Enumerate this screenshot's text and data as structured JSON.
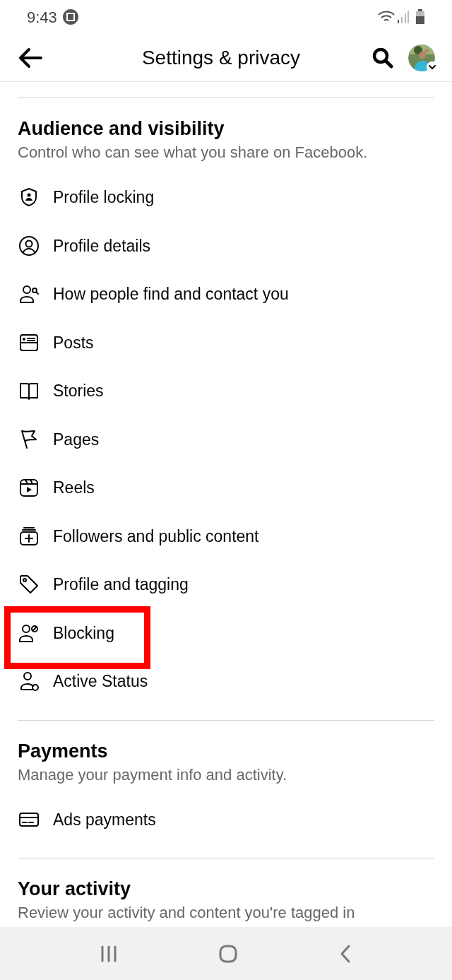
{
  "status_bar": {
    "time": "9:43"
  },
  "header": {
    "title": "Settings & privacy"
  },
  "sections": [
    {
      "title": "Audience and visibility",
      "subtitle": "Control who can see what you share on Facebook.",
      "items": [
        {
          "label": "Profile locking",
          "highlighted": false
        },
        {
          "label": "Profile details",
          "highlighted": false
        },
        {
          "label": "How people find and contact you",
          "highlighted": false
        },
        {
          "label": "Posts",
          "highlighted": false
        },
        {
          "label": "Stories",
          "highlighted": false
        },
        {
          "label": "Pages",
          "highlighted": false
        },
        {
          "label": "Reels",
          "highlighted": false
        },
        {
          "label": "Followers and public content",
          "highlighted": false
        },
        {
          "label": "Profile and tagging",
          "highlighted": false
        },
        {
          "label": "Blocking",
          "highlighted": true
        },
        {
          "label": "Active Status",
          "highlighted": false
        }
      ]
    },
    {
      "title": "Payments",
      "subtitle": "Manage your payment info and activity.",
      "items": [
        {
          "label": "Ads payments",
          "highlighted": false
        }
      ]
    },
    {
      "title": "Your activity",
      "subtitle": "Review your activity and content you're tagged in"
    }
  ]
}
